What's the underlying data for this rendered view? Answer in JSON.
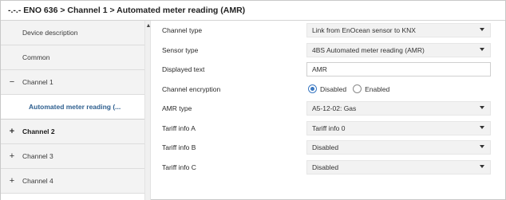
{
  "title": "-.-.- ENO 636 > Channel 1 > Automated meter reading (AMR)",
  "sidebar": {
    "items": [
      {
        "label": "Device description",
        "expander": ""
      },
      {
        "label": "Common",
        "expander": ""
      },
      {
        "label": "Channel 1",
        "expander": "−"
      },
      {
        "label": "Automated meter reading (...",
        "expander": ""
      },
      {
        "label": "Channel 2",
        "expander": "+"
      },
      {
        "label": "Channel 3",
        "expander": "+"
      },
      {
        "label": "Channel 4",
        "expander": "+"
      }
    ]
  },
  "params": [
    {
      "label": "Channel type",
      "value": "Link from EnOcean sensor to KNX"
    },
    {
      "label": "Sensor type",
      "value": "4BS Automated meter reading (AMR)"
    },
    {
      "label": "Displayed text",
      "value": "AMR"
    },
    {
      "label": "Channel encryption",
      "options": [
        "Disabled",
        "Enabled"
      ],
      "selected": "Disabled"
    },
    {
      "label": "AMR type",
      "value": "A5-12-02: Gas"
    },
    {
      "label": "Tariff info A",
      "value": "Tariff info 0"
    },
    {
      "label": "Tariff info B",
      "value": "Disabled"
    },
    {
      "label": "Tariff info C",
      "value": "Disabled"
    }
  ],
  "icons": {
    "expand": "plus-icon",
    "collapse": "minus-icon",
    "dropdown": "chevron-down-icon",
    "scroll_up": "scroll-up-arrow-icon"
  },
  "colors": {
    "accent": "#3a78c2",
    "active_text": "#2e5f8f",
    "sidebar_bg": "#f3f3f3",
    "select_bg": "#f2f2f2"
  }
}
